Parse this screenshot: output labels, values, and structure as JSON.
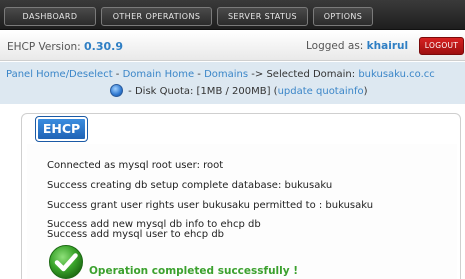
{
  "nav": {
    "items": [
      {
        "label": "DASHBOARD"
      },
      {
        "label": "OTHER OPERATIONS"
      },
      {
        "label": "SERVER STATUS"
      },
      {
        "label": "OPTIONS"
      }
    ]
  },
  "info": {
    "version_label": "EHCP Version:",
    "version": "0.30.9",
    "logged_label": "Logged as:",
    "username": "khairul",
    "logout_label": "LOGOUT"
  },
  "breadcrumb": {
    "panel_home": "Panel Home/Deselect",
    "sep1": " - ",
    "domain_home": "Domain Home",
    "sep2": " - ",
    "domains": "Domains",
    "selected_label": " -> Selected Domain: ",
    "selected_domain": "bukusaku.co.cc",
    "quota_text": " - Disk Quota: [1MB / 200MB] (",
    "quota_link": "update quotainfo",
    "quota_close": ")",
    "quota_icon": "globe-icon"
  },
  "panel": {
    "tab_label": "EHCP",
    "messages": [
      "Connected as mysql root user: root",
      "Success creating db setup complete database: bukusaku",
      "Success grant user rights user bukusaku permitted to : bukusaku",
      "Success add new mysql db info to ehcp db",
      "Success add mysql user to ehcp db"
    ],
    "success_icon": "checkmark-icon",
    "success_text": "Operation completed successfully !"
  },
  "colors": {
    "accent_blue": "#2f7fc4",
    "logout_red": "#c41919",
    "success_green": "#3ba12e"
  }
}
